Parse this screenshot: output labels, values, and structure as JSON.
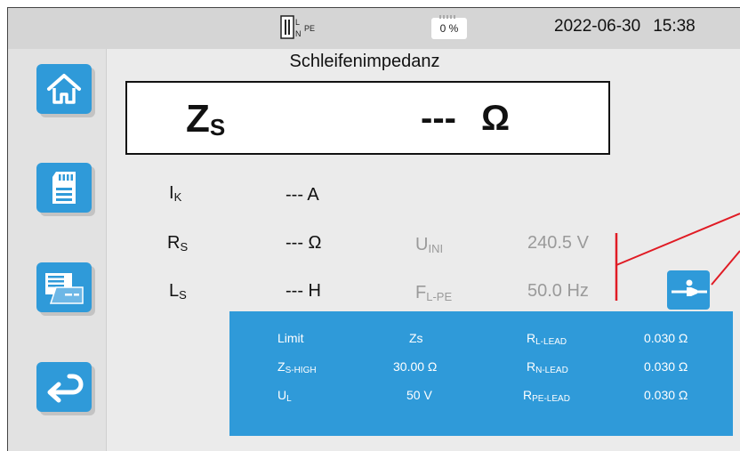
{
  "status": {
    "connection_icon": "plug-l-n-pe-icon",
    "connection_l": "L",
    "connection_n": "N",
    "connection_pe": "PE",
    "battery_icon": "battery-icon",
    "battery_percent": "0 %",
    "date": "2022-06-30",
    "time": "15:38"
  },
  "sidebar": {
    "items": [
      {
        "icon": "home-icon"
      },
      {
        "icon": "memory-card-icon"
      },
      {
        "icon": "records-list-icon"
      },
      {
        "icon": "back-arrow-icon"
      }
    ]
  },
  "title": "Schleifenimpedanz",
  "main": {
    "label": "Z",
    "label_sub": "S",
    "value": "---",
    "unit": "Ω"
  },
  "results": [
    {
      "label": "I",
      "sub": "K",
      "value": "--- A"
    },
    {
      "label": "R",
      "sub": "S",
      "value": "--- Ω"
    },
    {
      "label": "L",
      "sub": "S",
      "value": "--- H"
    }
  ],
  "inputs": [
    {
      "label": "U",
      "sub": "INI",
      "value": "240.5 V"
    },
    {
      "label": "F",
      "sub": "L-PE",
      "value": "50.0 Hz"
    }
  ],
  "lead_button_icon": "lead-compensation-icon",
  "limits": {
    "col1": [
      {
        "label": "Limit",
        "sub": ""
      },
      {
        "label": "Z",
        "sub": "S-HIGH"
      },
      {
        "label": "U",
        "sub": "L"
      }
    ],
    "col2": [
      "Zs",
      "30.00 Ω",
      "50 V"
    ],
    "col3": [
      {
        "label": "R",
        "sub": "L-LEAD"
      },
      {
        "label": "R",
        "sub": "N-LEAD"
      },
      {
        "label": "R",
        "sub": "PE-LEAD"
      }
    ],
    "col4": [
      "0.030 Ω",
      "0.030 Ω",
      "0.030 Ω"
    ]
  },
  "colors": {
    "accent": "#2f9ad9",
    "annotation": "#e01b24"
  }
}
